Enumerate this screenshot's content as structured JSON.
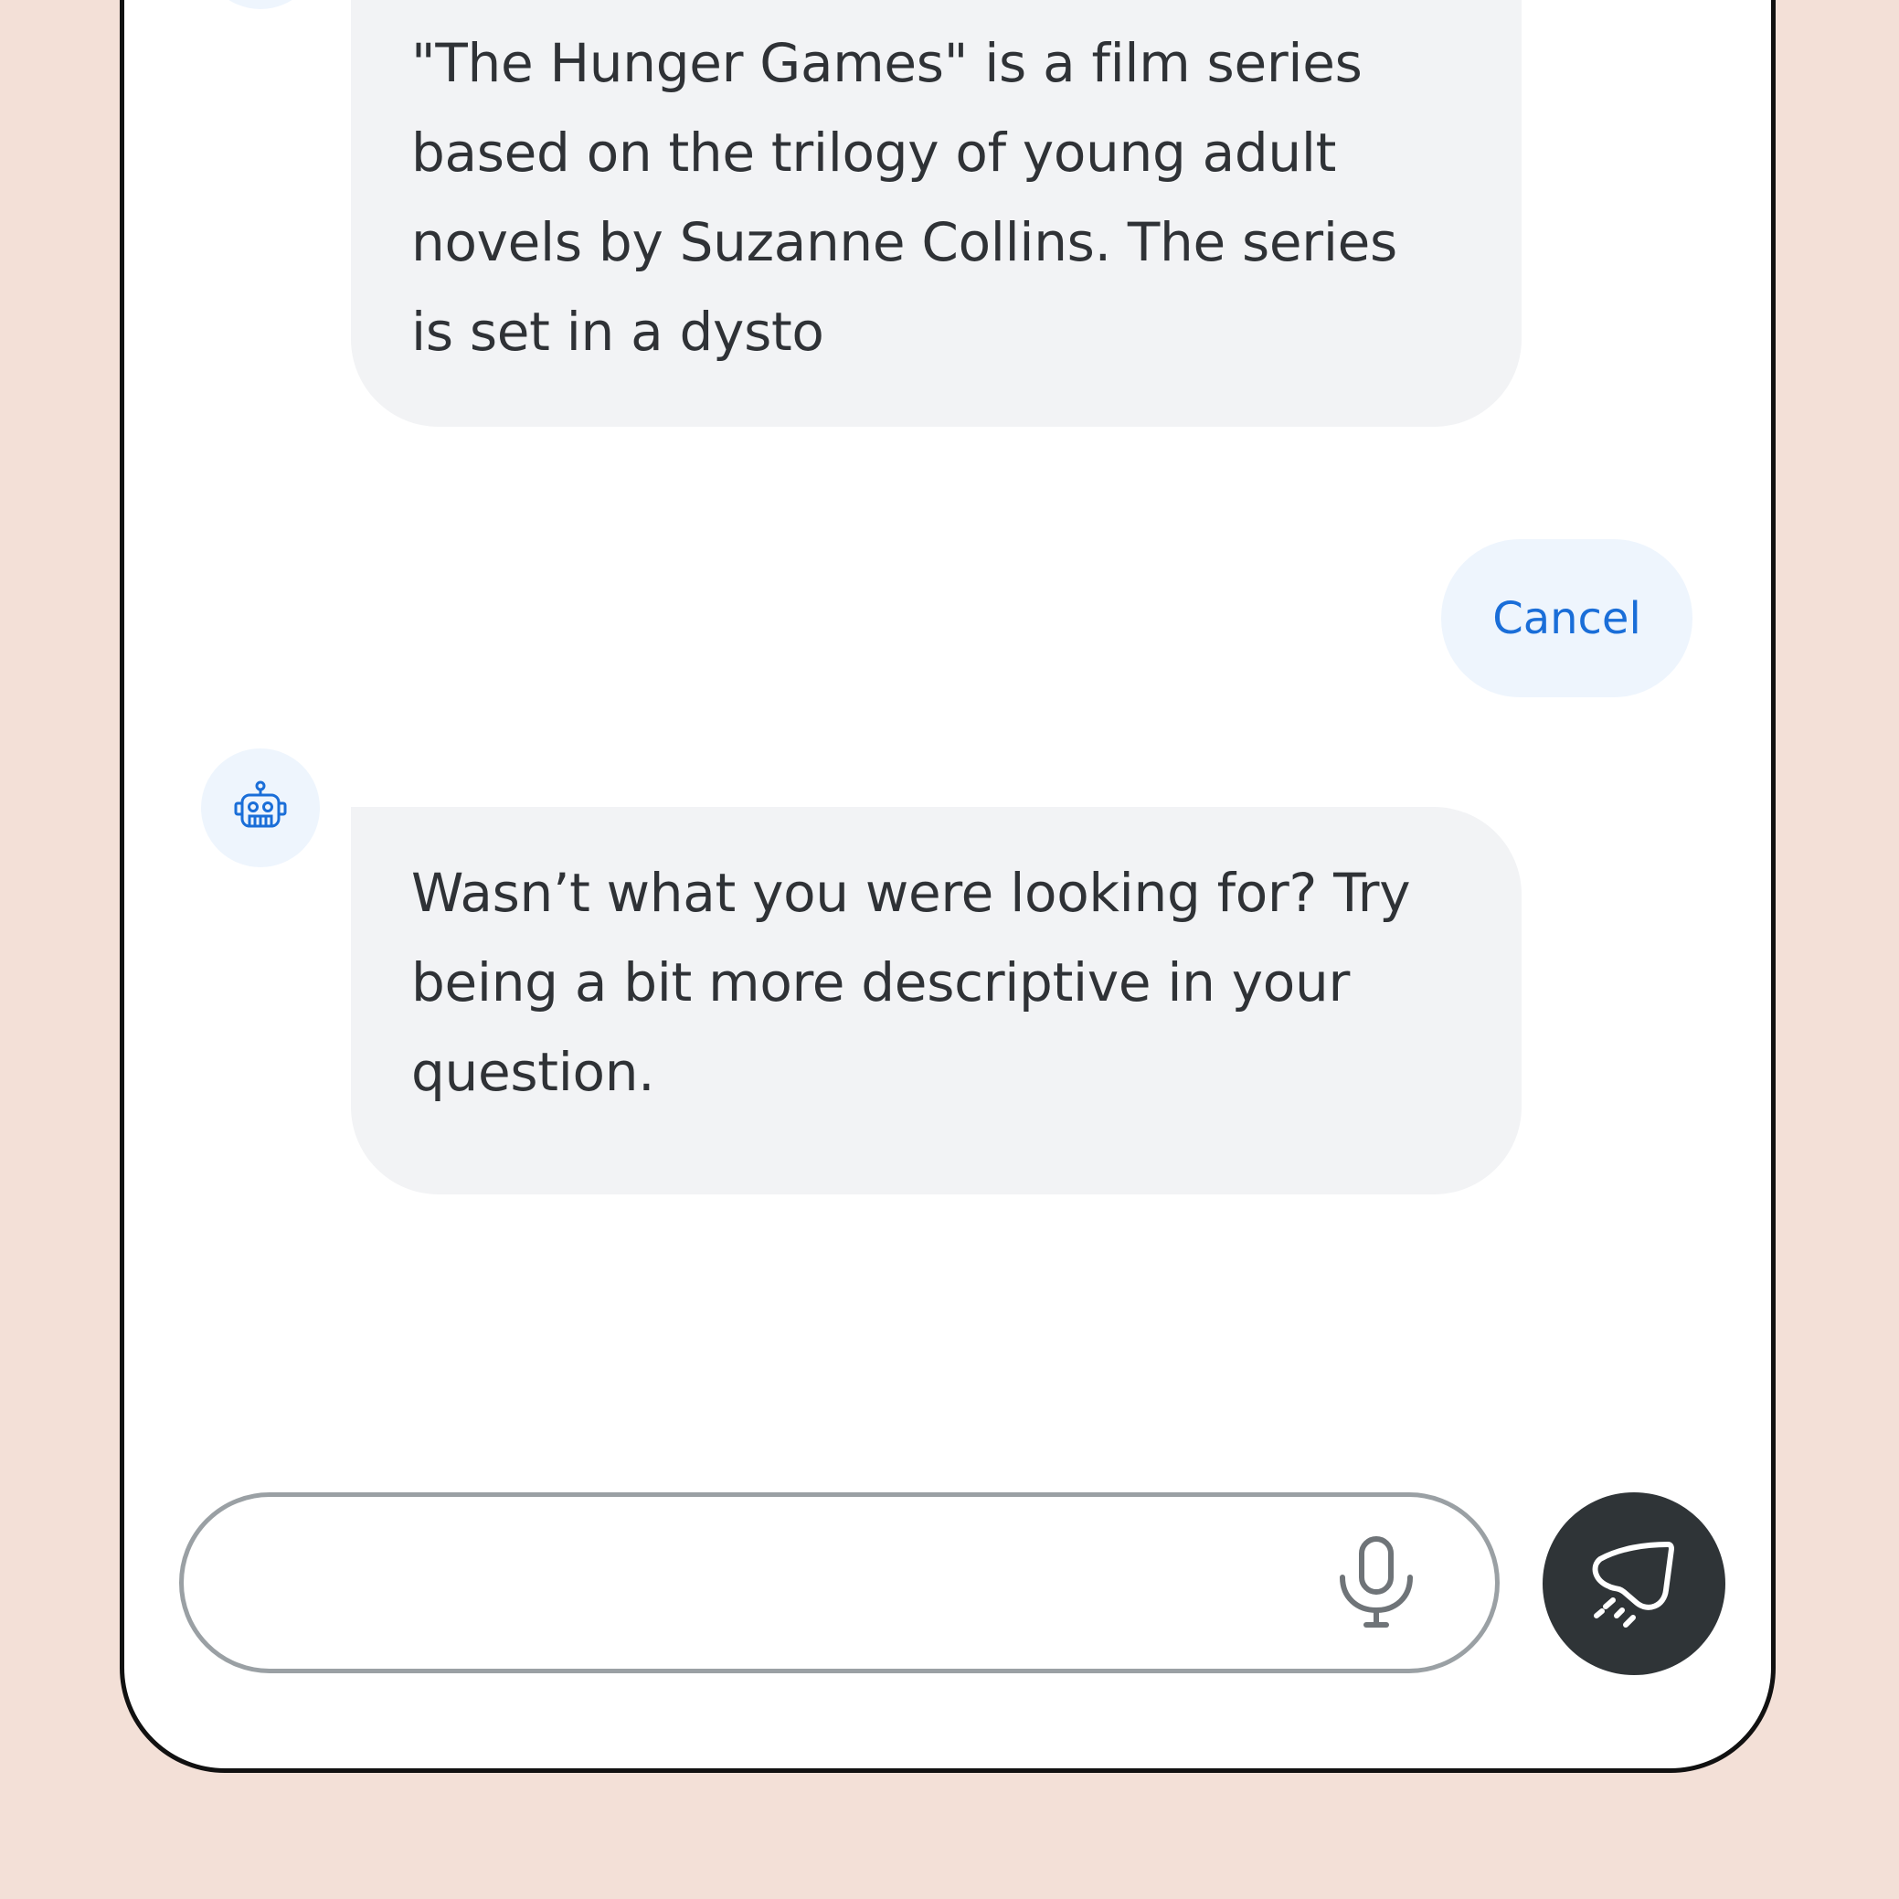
{
  "chat": {
    "messages": [
      {
        "role": "bot",
        "text": "\"The Hunger Games\" is a film series\nbased on the trilogy of young adult\nnovels by Suzanne Collins. The series\nis set in a dysto"
      },
      {
        "role": "user",
        "text": "Cancel"
      },
      {
        "role": "bot",
        "text": "Wasn’t what you were looking for? Try\nbeing a bit more descriptive in your\nquestion."
      }
    ]
  },
  "composer": {
    "value": "",
    "placeholder": ""
  },
  "icons": {
    "bot_avatar": "robot-icon",
    "mic": "microphone-icon",
    "send": "send-icon"
  },
  "colors": {
    "background": "#F3E0D7",
    "accent": "#1A6ED8",
    "bubble_bot": "#F2F3F5",
    "bubble_user": "#EEF5FD",
    "send_button": "#2F3437",
    "text": "#2F3236"
  }
}
